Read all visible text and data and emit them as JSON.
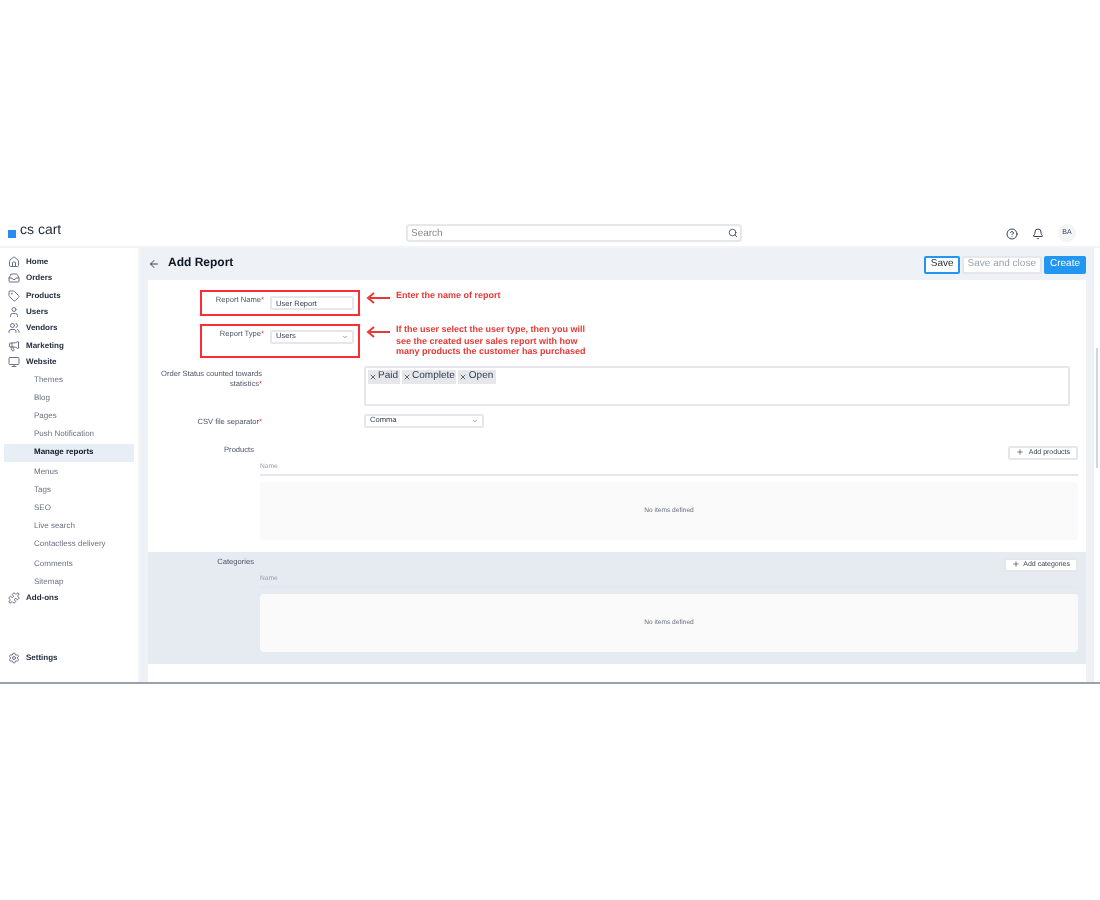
{
  "header": {
    "logo": "cs cart",
    "search": {
      "placeholder": "Search"
    },
    "avatar": "BA"
  },
  "sidebar": {
    "items": [
      {
        "label": "Home",
        "selected": false
      },
      {
        "label": "Orders",
        "selected": false
      },
      {
        "label": "Products",
        "selected": false
      },
      {
        "label": "Users",
        "selected": false
      },
      {
        "label": "Vendors",
        "selected": false
      },
      {
        "label": "Marketing",
        "selected": false
      },
      {
        "label": "Website",
        "selected": false,
        "children": [
          {
            "label": "Themes",
            "selected": false
          },
          {
            "label": "Blog",
            "selected": false
          },
          {
            "label": "Pages",
            "selected": false
          },
          {
            "label": "Push Notification",
            "selected": false
          },
          {
            "label": "Manage reports",
            "selected": true
          },
          {
            "label": "Menus",
            "selected": false
          },
          {
            "label": "Tags",
            "selected": false
          },
          {
            "label": "SEO",
            "selected": false
          },
          {
            "label": "Live search",
            "selected": false
          },
          {
            "label": "Contactless delivery",
            "selected": false
          },
          {
            "label": "Comments",
            "selected": false
          },
          {
            "label": "Sitemap",
            "selected": false
          }
        ]
      },
      {
        "label": "Add-ons",
        "selected": false
      }
    ],
    "footer": {
      "label": "Settings"
    }
  },
  "page": {
    "title": "Add Report",
    "buttons": [
      {
        "label": "Save",
        "kind": "outline"
      },
      {
        "label": "Save and close",
        "kind": "ghost"
      },
      {
        "label": "Create",
        "kind": "primary"
      }
    ]
  },
  "form": {
    "fields": [
      {
        "kind": "input",
        "label": "Report Name",
        "required": "*",
        "value": "User Report",
        "highlighted": true,
        "annotation": "Enter the name of report"
      },
      {
        "kind": "select",
        "label": "Report Type",
        "required": "*",
        "value": "Users",
        "highlighted": true,
        "annotation": "If the user select the user type, then you will see the created user sales report with how many products the customer has purchased"
      },
      {
        "kind": "tags",
        "label": "Order Status counted towards statistics",
        "required": "*",
        "tags": [
          "Paid",
          "Complete",
          "Open"
        ],
        "highlighted": false
      },
      {
        "kind": "select",
        "label": "CSV file separator",
        "required": "*",
        "value": "Comma",
        "highlighted": false
      }
    ],
    "sections": [
      {
        "label": "Products",
        "button": "Add products",
        "column": "Name",
        "empty": "No items defined",
        "shaded": false
      },
      {
        "label": "Categories",
        "button": "Add categories",
        "column": "Name",
        "empty": "No items defined",
        "shaded": true
      }
    ]
  }
}
